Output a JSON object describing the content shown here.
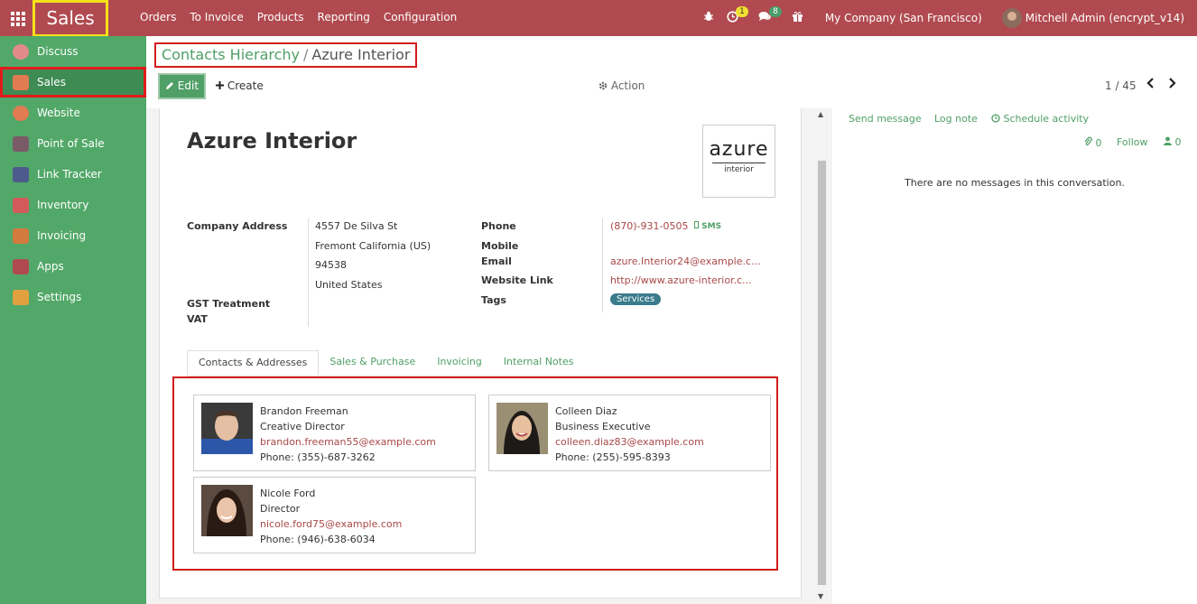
{
  "navbar": {
    "app_name": "Sales",
    "menu": [
      "Orders",
      "To Invoice",
      "Products",
      "Reporting",
      "Configuration"
    ],
    "activity_count": "1",
    "message_count": "8",
    "company": "My Company (San Francisco)",
    "user": "Mitchell Admin (encrypt_v14)",
    "icons": [
      "apps-grid-icon",
      "bug-icon",
      "clock-icon",
      "chat-icon",
      "gift-icon"
    ]
  },
  "sidebar": {
    "items": [
      {
        "label": "Discuss",
        "color": "#e28a8a"
      },
      {
        "label": "Sales",
        "color": "#e07b52"
      },
      {
        "label": "Website",
        "color": "#e07b52"
      },
      {
        "label": "Point of Sale",
        "color": "#7a5c68"
      },
      {
        "label": "Link Tracker",
        "color": "#4c5b8c"
      },
      {
        "label": "Inventory",
        "color": "#d35a5a"
      },
      {
        "label": "Invoicing",
        "color": "#d37a3e"
      },
      {
        "label": "Apps",
        "color": "#b04a50"
      },
      {
        "label": "Settings",
        "color": "#e0a13e"
      }
    ],
    "active": "Sales"
  },
  "breadcrumb": {
    "parent": "Contacts Hierarchy",
    "separator": "/",
    "current": "Azure Interior"
  },
  "controls": {
    "edit": "Edit",
    "create": "Create",
    "action": "Action",
    "pager": "1 / 45"
  },
  "record": {
    "name": "Azure Interior",
    "logo_text": "azure",
    "logo_sub": "interior",
    "labels": {
      "company_address": "Company Address",
      "gst": "GST Treatment",
      "vat": "VAT",
      "phone": "Phone",
      "mobile": "Mobile",
      "email": "Email",
      "website": "Website Link",
      "tags": "Tags"
    },
    "address": [
      "4557 De Silva St",
      "Fremont California (US)",
      "94538",
      "United States"
    ],
    "phone": "(870)-931-0505",
    "sms": "SMS",
    "email": "azure.Interior24@example.c...",
    "website": "http://www.azure-interior.c...",
    "tag": "Services"
  },
  "tabs": [
    "Contacts & Addresses",
    "Sales & Purchase",
    "Invoicing",
    "Internal Notes"
  ],
  "contacts": [
    {
      "name": "Brandon Freeman",
      "title": "Creative Director",
      "email": "brandon.freeman55@example.com",
      "phone": "Phone: (355)-687-3262"
    },
    {
      "name": "Colleen Diaz",
      "title": "Business Executive",
      "email": "colleen.diaz83@example.com",
      "phone": "Phone: (255)-595-8393"
    },
    {
      "name": "Nicole Ford",
      "title": "Director",
      "email": "nicole.ford75@example.com",
      "phone": "Phone: (946)-638-6034"
    }
  ],
  "chatter": {
    "send_message": "Send message",
    "log_note": "Log note",
    "schedule_activity": "Schedule activity",
    "attachments": "0",
    "follow": "Follow",
    "followers": "0",
    "empty": "There are no messages in this conversation."
  }
}
